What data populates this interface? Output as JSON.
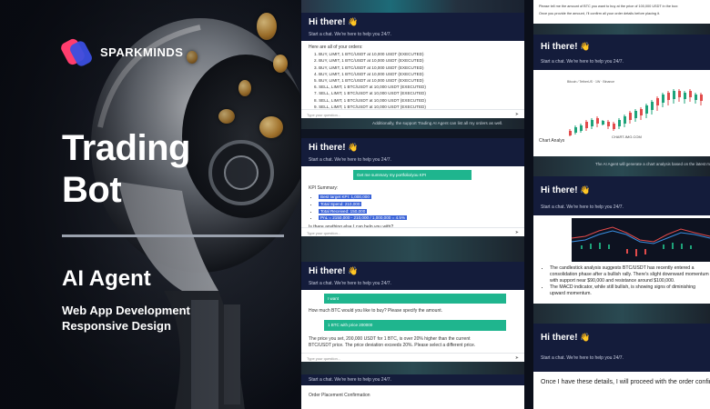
{
  "brand": {
    "name": "SPARKMINDS"
  },
  "hero": {
    "title_line1": "Trading",
    "title_line2": "Bot",
    "subtitle": "AI Agent",
    "tagline_line1": "Web App Development",
    "tagline_line2": "Responsive Design"
  },
  "chat": {
    "greeting": "Hi there!",
    "wave": "👋",
    "start_text": "Start a chat. We're here to help you 24/7.",
    "input_placeholder": "Type your question..."
  },
  "mid_panel1": {
    "intro": "Here are all of your orders:",
    "orders": [
      "1. BUY, LIMIT, 1 BTC/USDT at 10,000 USDT (EXECUTED)",
      "2. BUY, LIMIT, 1 BTC/USDT at 10,000 USDT (EXECUTED)",
      "3. BUY, LIMIT, 1 BTC/USDT at 10,000 USDT (EXECUTED)",
      "4. BUY, LIMIT, 1 BTC/USDT at 10,000 USDT (EXECUTED)",
      "5. BUY, LIMIT, 1 BTC/USDT at 10,000 USDT (EXECUTED)",
      "6. SELL, LIMIT, 1 BTC/USDT at 10,000 USDT (EXECUTED)",
      "7. SELL, LIMIT, 1 BTC/USDT at 10,000 USDT (EXECUTED)",
      "8. SELL, LIMIT, 1 BTC/USDT at 10,000 USDT (EXECUTED)",
      "9. SELL, LIMIT, 1 BTC/USDT at 10,000 USDT (EXECUTED)",
      "10. SELL, LIMIT, 1 BTC/USDT at 10,000 USDT (EXECUTED)"
    ],
    "caption": "Additionally, the support Trading AI Agent can list all my orders as well."
  },
  "mid_panel2": {
    "user_msg": "Get me summary my portfolio/you KPI",
    "kpi_title": "KPI Summary:",
    "kpis": [
      "Best target KPI: 1,000,000",
      "Total Spend: 210,000",
      "Total Received: 150,000",
      "PnL = 2150,000 - 210,000 / 1,000,000 = 4.5%"
    ],
    "followup": "Is there anything else I can help you with?"
  },
  "mid_panel3": {
    "user_msg1": "I want",
    "bot_msg1": "How much BTC would you like to buy? Please specify the amount.",
    "user_msg2": "1 BTC with price 200000",
    "bot_msg2": "The price you set, 200,000 USDT for 1 BTC, is over 20% higher than the current BTC/USDT price. The price deviation exceeds 20%. Please select a different price."
  },
  "mid_panel4": {
    "title": "Order Placement Confirmation"
  },
  "right_panel1": {
    "line1": "Please tell me the amount of BTC you want to buy at the price of 100,000 USDT in the box:",
    "line2": "Once you provide the amount, I'll confirm all your order details before placing it."
  },
  "right_panel2": {
    "chart_header": "Bitcoin / TetherUS · 1W · Binance",
    "label": "Chart Analysis",
    "watermark": "CHART-IMG.COM",
    "caption": "The AI Agent will generate a chart analysis based on the latest market data"
  },
  "right_panel3": {
    "bullet1": "The candlestick analysis suggests BTC/USDT has recently entered a consolidation phase after a bullish rally. There's slight downward momentum with support near $90,000 and resistance around $100,000.",
    "bullet2": "The MACD indicator, while still bullish, is showing signs of diminishing upward momentum."
  },
  "right_panel4": {
    "confirm_text": "Once I have these details, I will proceed with the order confirmation."
  },
  "colors": {
    "chat_header": "#141c3b",
    "user_bubble": "#1fb58e",
    "highlight": "#3a63d8",
    "brand_pink": "#ff3d6e",
    "brand_blue": "#3b4fe0"
  }
}
